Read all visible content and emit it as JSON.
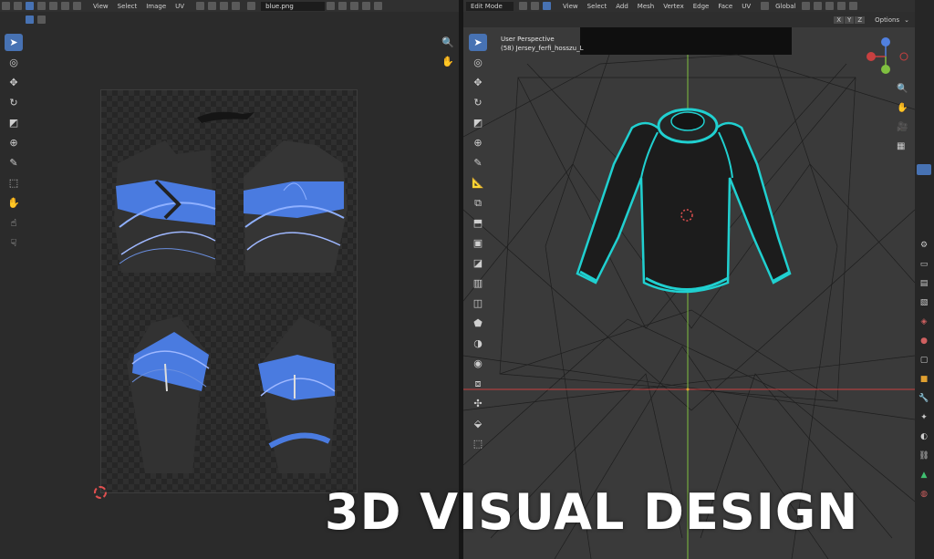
{
  "uv_editor": {
    "menu": [
      "View",
      "Select",
      "Image",
      "UV"
    ],
    "image_name": "blue.png",
    "tools": [
      "cursor-select",
      "cursor-3d",
      "move",
      "rotate",
      "scale",
      "transform",
      "annotate",
      "rip",
      "grab",
      "relax",
      "pinch"
    ]
  },
  "viewport": {
    "mode": "Edit Mode",
    "menu": [
      "View",
      "Select",
      "Add",
      "Mesh",
      "Vertex",
      "Edge",
      "Face",
      "UV"
    ],
    "orientation": "Global",
    "axes": [
      "X",
      "Y",
      "Z"
    ],
    "options_label": "Options",
    "perspective_label": "User Perspective",
    "object_label": "(58) Jersey_ferfi_hosszu_L"
  },
  "overlay": {
    "title": "3D VISUAL DESIGN"
  },
  "colors": {
    "accent": "#4772b3",
    "mesh_highlight": "#20d0d0",
    "uv_blue": "#4a7be0",
    "x_axis": "#c84040",
    "y_axis": "#80c040"
  }
}
